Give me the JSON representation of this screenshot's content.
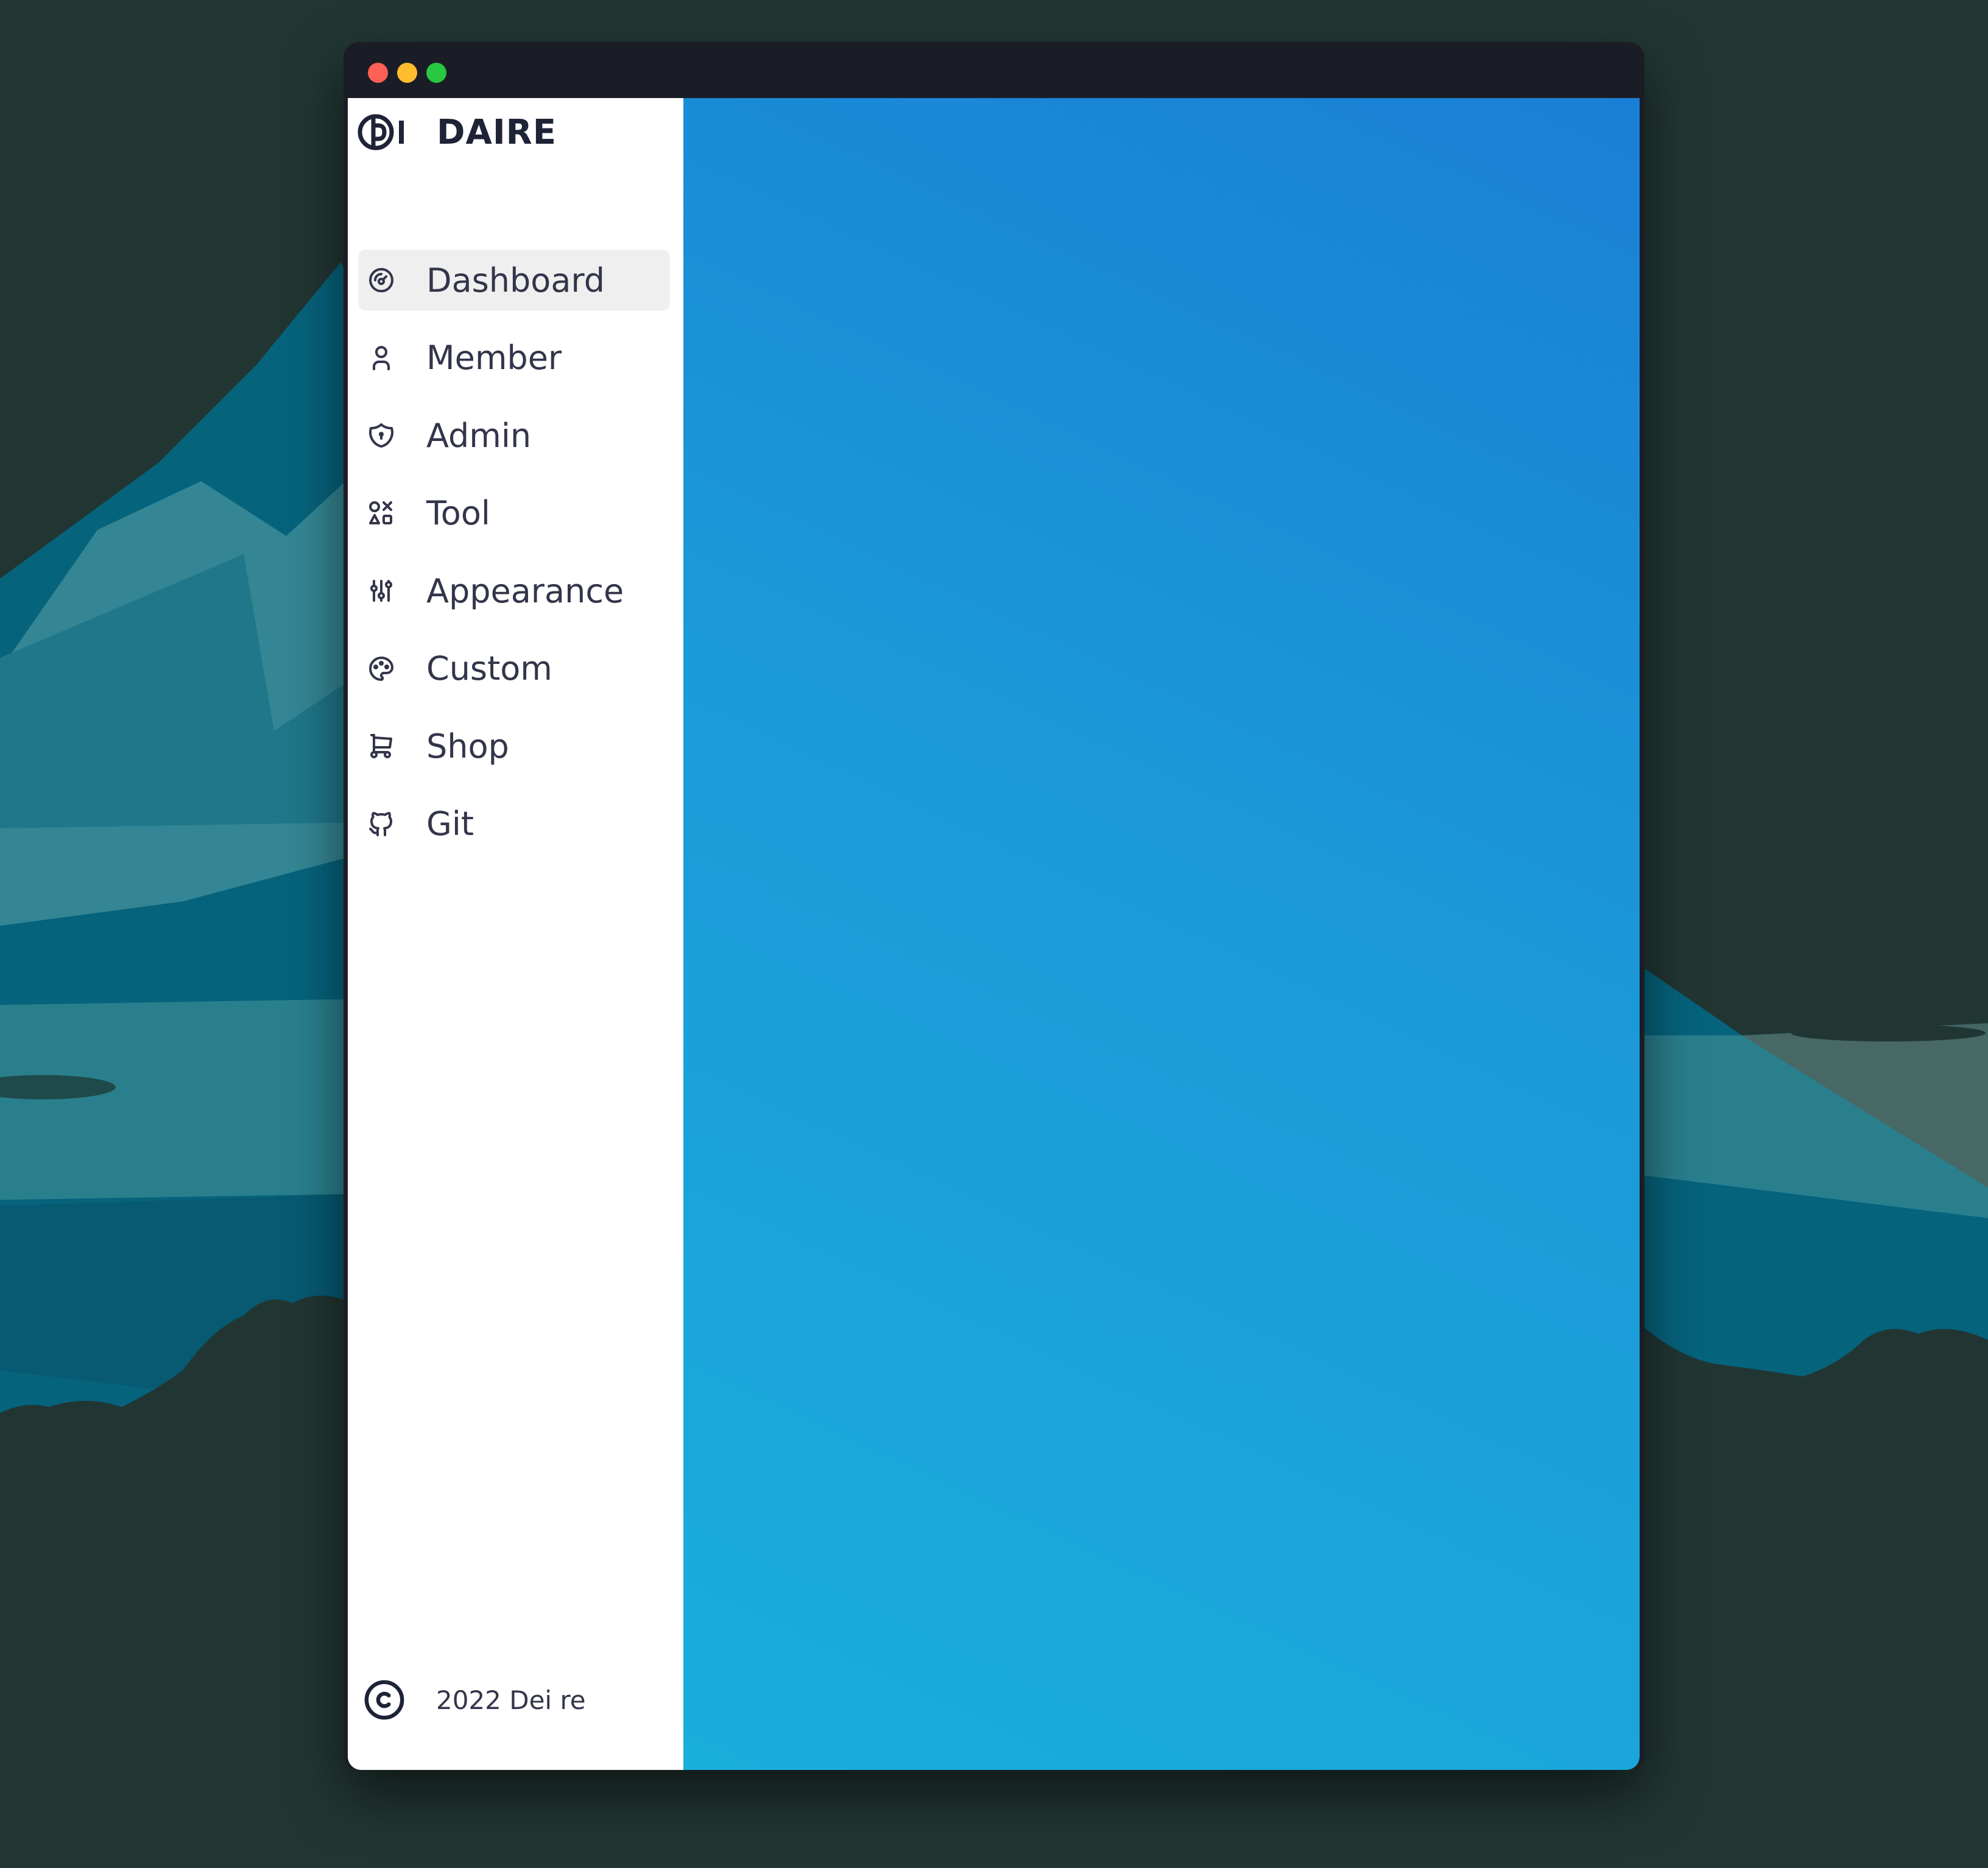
{
  "window": {
    "traffic_lights": {
      "close": "#fe5f57",
      "minimize": "#febc2e",
      "maximize": "#28c840"
    }
  },
  "sidebar": {
    "brand": {
      "name": "DAIRE",
      "logo_icon": "daire-logo-icon"
    },
    "items": [
      {
        "label": "Dashboard",
        "icon": "gauge-icon",
        "active": true
      },
      {
        "label": "Member",
        "icon": "user-icon",
        "active": false
      },
      {
        "label": "Admin",
        "icon": "shield-icon",
        "active": false
      },
      {
        "label": "Tool",
        "icon": "shapes-icon",
        "active": false
      },
      {
        "label": "Appearance",
        "icon": "sliders-icon",
        "active": false
      },
      {
        "label": "Custom",
        "icon": "palette-icon",
        "active": false
      },
      {
        "label": "Shop",
        "icon": "cart-icon",
        "active": false
      },
      {
        "label": "Git",
        "icon": "github-icon",
        "active": false
      }
    ],
    "footer": {
      "text": "2022 Dei re",
      "icon": "copyright-icon"
    }
  },
  "main": {
    "gradient": [
      "#1a7fd6",
      "#1aaedb"
    ]
  },
  "colors": {
    "desktop_background": "#213633",
    "window_frame": "#1b1d26",
    "active_item_bg": "#efefef",
    "text": "#33354a"
  }
}
